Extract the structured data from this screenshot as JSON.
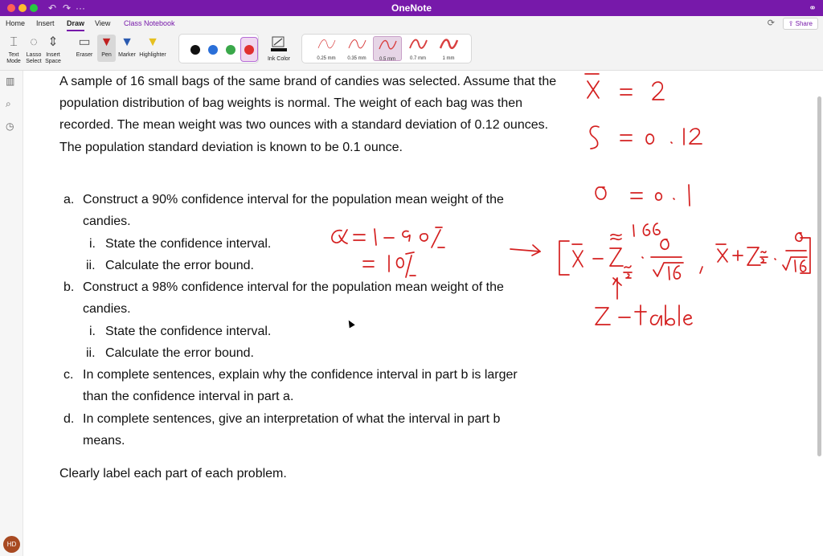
{
  "window": {
    "title": "OneNote",
    "share_label": "Share"
  },
  "menu": {
    "tabs": [
      "Home",
      "Insert",
      "Draw",
      "View",
      "Class Notebook"
    ],
    "active_tab": "Draw"
  },
  "ribbon": {
    "tools": [
      "Text Mode",
      "Lasso Select",
      "Insert Space",
      "Eraser",
      "Pen",
      "Marker",
      "Highlighter"
    ],
    "ink_color_label": "Ink Color",
    "colors": [
      "#111111",
      "#2a6fd8",
      "#3aa84a",
      "#e03030"
    ],
    "selected_color": "#e03030",
    "widths": [
      "0.25 mm",
      "0.35 mm",
      "0.5 mm",
      "0.7 mm",
      "1 mm"
    ],
    "selected_width": "0.5 mm"
  },
  "user": {
    "initials": "HD"
  },
  "note": {
    "intro": "A sample of 16 small bags of the same brand of candies was selected. Assume that the population distribution of bag weights is normal. The weight of each bag was then recorded. The mean weight was two ounces with a standard deviation of 0.12 ounces. The population standard deviation is known to be 0.1 ounce.",
    "parts": [
      {
        "mark": "a.",
        "text": "Construct a 90% confidence interval for the population mean weight of the candies."
      },
      {
        "mark": "i.",
        "text": "State the confidence interval."
      },
      {
        "mark": "ii.",
        "text": "Calculate the error bound."
      },
      {
        "mark": "b.",
        "text": "Construct a 98% confidence interval for the population mean weight of the candies."
      },
      {
        "mark": "i.",
        "text": "State the confidence interval."
      },
      {
        "mark": "ii.",
        "text": "Calculate the error bound."
      },
      {
        "mark": "c.",
        "text": "In complete sentences, explain why the confidence interval in part b is larger than the confidence interval in part a."
      },
      {
        "mark": "d.",
        "text": "In complete sentences, give an interpretation of what the interval in part b means."
      }
    ],
    "footer": "Clearly label each part of each problem."
  }
}
